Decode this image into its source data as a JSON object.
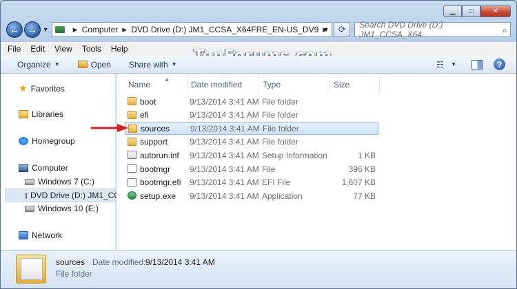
{
  "window": {
    "caption": {
      "minimize": "▁",
      "maximize": "□",
      "close": "✕"
    }
  },
  "navbar": {
    "back_glyph": "←",
    "forward_glyph": "→",
    "address": {
      "computer": "Computer",
      "drive": "DVD Drive (D:) JM1_CCSA_X64FRE_EN-US_DV9"
    },
    "search_placeholder": "Search DVD Drive (D:) JM1_CCSA_X64..."
  },
  "menubar": [
    "File",
    "Edit",
    "View",
    "Tools",
    "Help"
  ],
  "watermark": "TenForums.com",
  "cmdbar": {
    "organize": "Organize",
    "open": "Open",
    "share_with": "Share with"
  },
  "navpane": {
    "favorites": "Favorites",
    "libraries": "Libraries",
    "homegroup": "Homegroup",
    "computer": "Computer",
    "windows7": "Windows 7 (C:)",
    "dvd": "DVD Drive (D:) JM1_CC",
    "windows10": "Windows 10 (E:)",
    "network": "Network"
  },
  "columns": {
    "name": "Name",
    "date": "Date modified",
    "type": "Type",
    "size": "Size"
  },
  "files": [
    {
      "name": "boot",
      "date": "9/13/2014 3:41 AM",
      "type": "File folder",
      "size": "",
      "icon": "folder"
    },
    {
      "name": "efi",
      "date": "9/13/2014 3:41 AM",
      "type": "File folder",
      "size": "",
      "icon": "folder"
    },
    {
      "name": "sources",
      "date": "9/13/2014 3:41 AM",
      "type": "File folder",
      "size": "",
      "icon": "folder"
    },
    {
      "name": "support",
      "date": "9/13/2014 3:41 AM",
      "type": "File folder",
      "size": "",
      "icon": "folder"
    },
    {
      "name": "autorun.inf",
      "date": "9/13/2014 3:41 AM",
      "type": "Setup Information",
      "size": "1 KB",
      "icon": "inf"
    },
    {
      "name": "bootmgr",
      "date": "9/13/2014 3:41 AM",
      "type": "File",
      "size": "396 KB",
      "icon": "plain"
    },
    {
      "name": "bootmgr.efi",
      "date": "9/13/2014 3:41 AM",
      "type": "EFI File",
      "size": "1,607 KB",
      "icon": "plain"
    },
    {
      "name": "setup.exe",
      "date": "9/13/2014 3:41 AM",
      "type": "Application",
      "size": "77 KB",
      "icon": "exe"
    }
  ],
  "details": {
    "name": "sources",
    "date_label": "Date modified:",
    "date": "9/13/2014 3:41 AM",
    "type": "File folder"
  },
  "colors": {
    "accent": "#2d5fa6",
    "arrow": "#e01b1b",
    "selection": "#cfe3f8"
  }
}
